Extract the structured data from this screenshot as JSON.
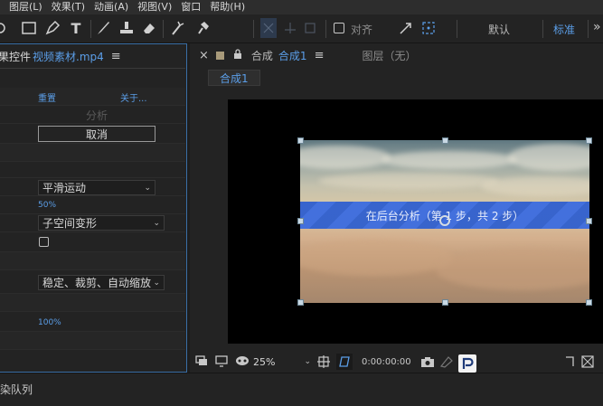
{
  "menu": [
    "图层(L)",
    "效果(T)",
    "动画(A)",
    "视图(V)",
    "窗口",
    "帮助(H)"
  ],
  "toolbar": {
    "snap_label": "对齐",
    "workspace_default": "默认",
    "workspace_standard": "标准"
  },
  "effects_panel": {
    "title_prefix": "果控件",
    "file_name": "视频素材.mp4",
    "menu_icon": "≡",
    "reset_link": "重置",
    "about_link": "关于...",
    "analyze_label": "分析",
    "cancel_label": "取消",
    "smoothness_value": "50%",
    "result_option": "平滑运动",
    "method_option": "子空间变形",
    "framing_option": "稳定、裁剪、自动缩放",
    "scale_value": "100%"
  },
  "comp_panel": {
    "close_icon": "×",
    "comp_tab_prefix": "合成",
    "comp_name": "合成1",
    "menu_icon": "≡",
    "layer_tab": "图层（无）",
    "sub_tab": "合成1",
    "progress_text": "在后台分析（第 1 步，共 2 步）",
    "zoom": "25%",
    "timecode": "0:00:00:00"
  },
  "status_bar": {
    "render_queue": "染队列"
  },
  "colors": {
    "accent_blue": "#5b9ee8",
    "panel_bg": "#232323",
    "progress_band": "#2f5fcf"
  }
}
